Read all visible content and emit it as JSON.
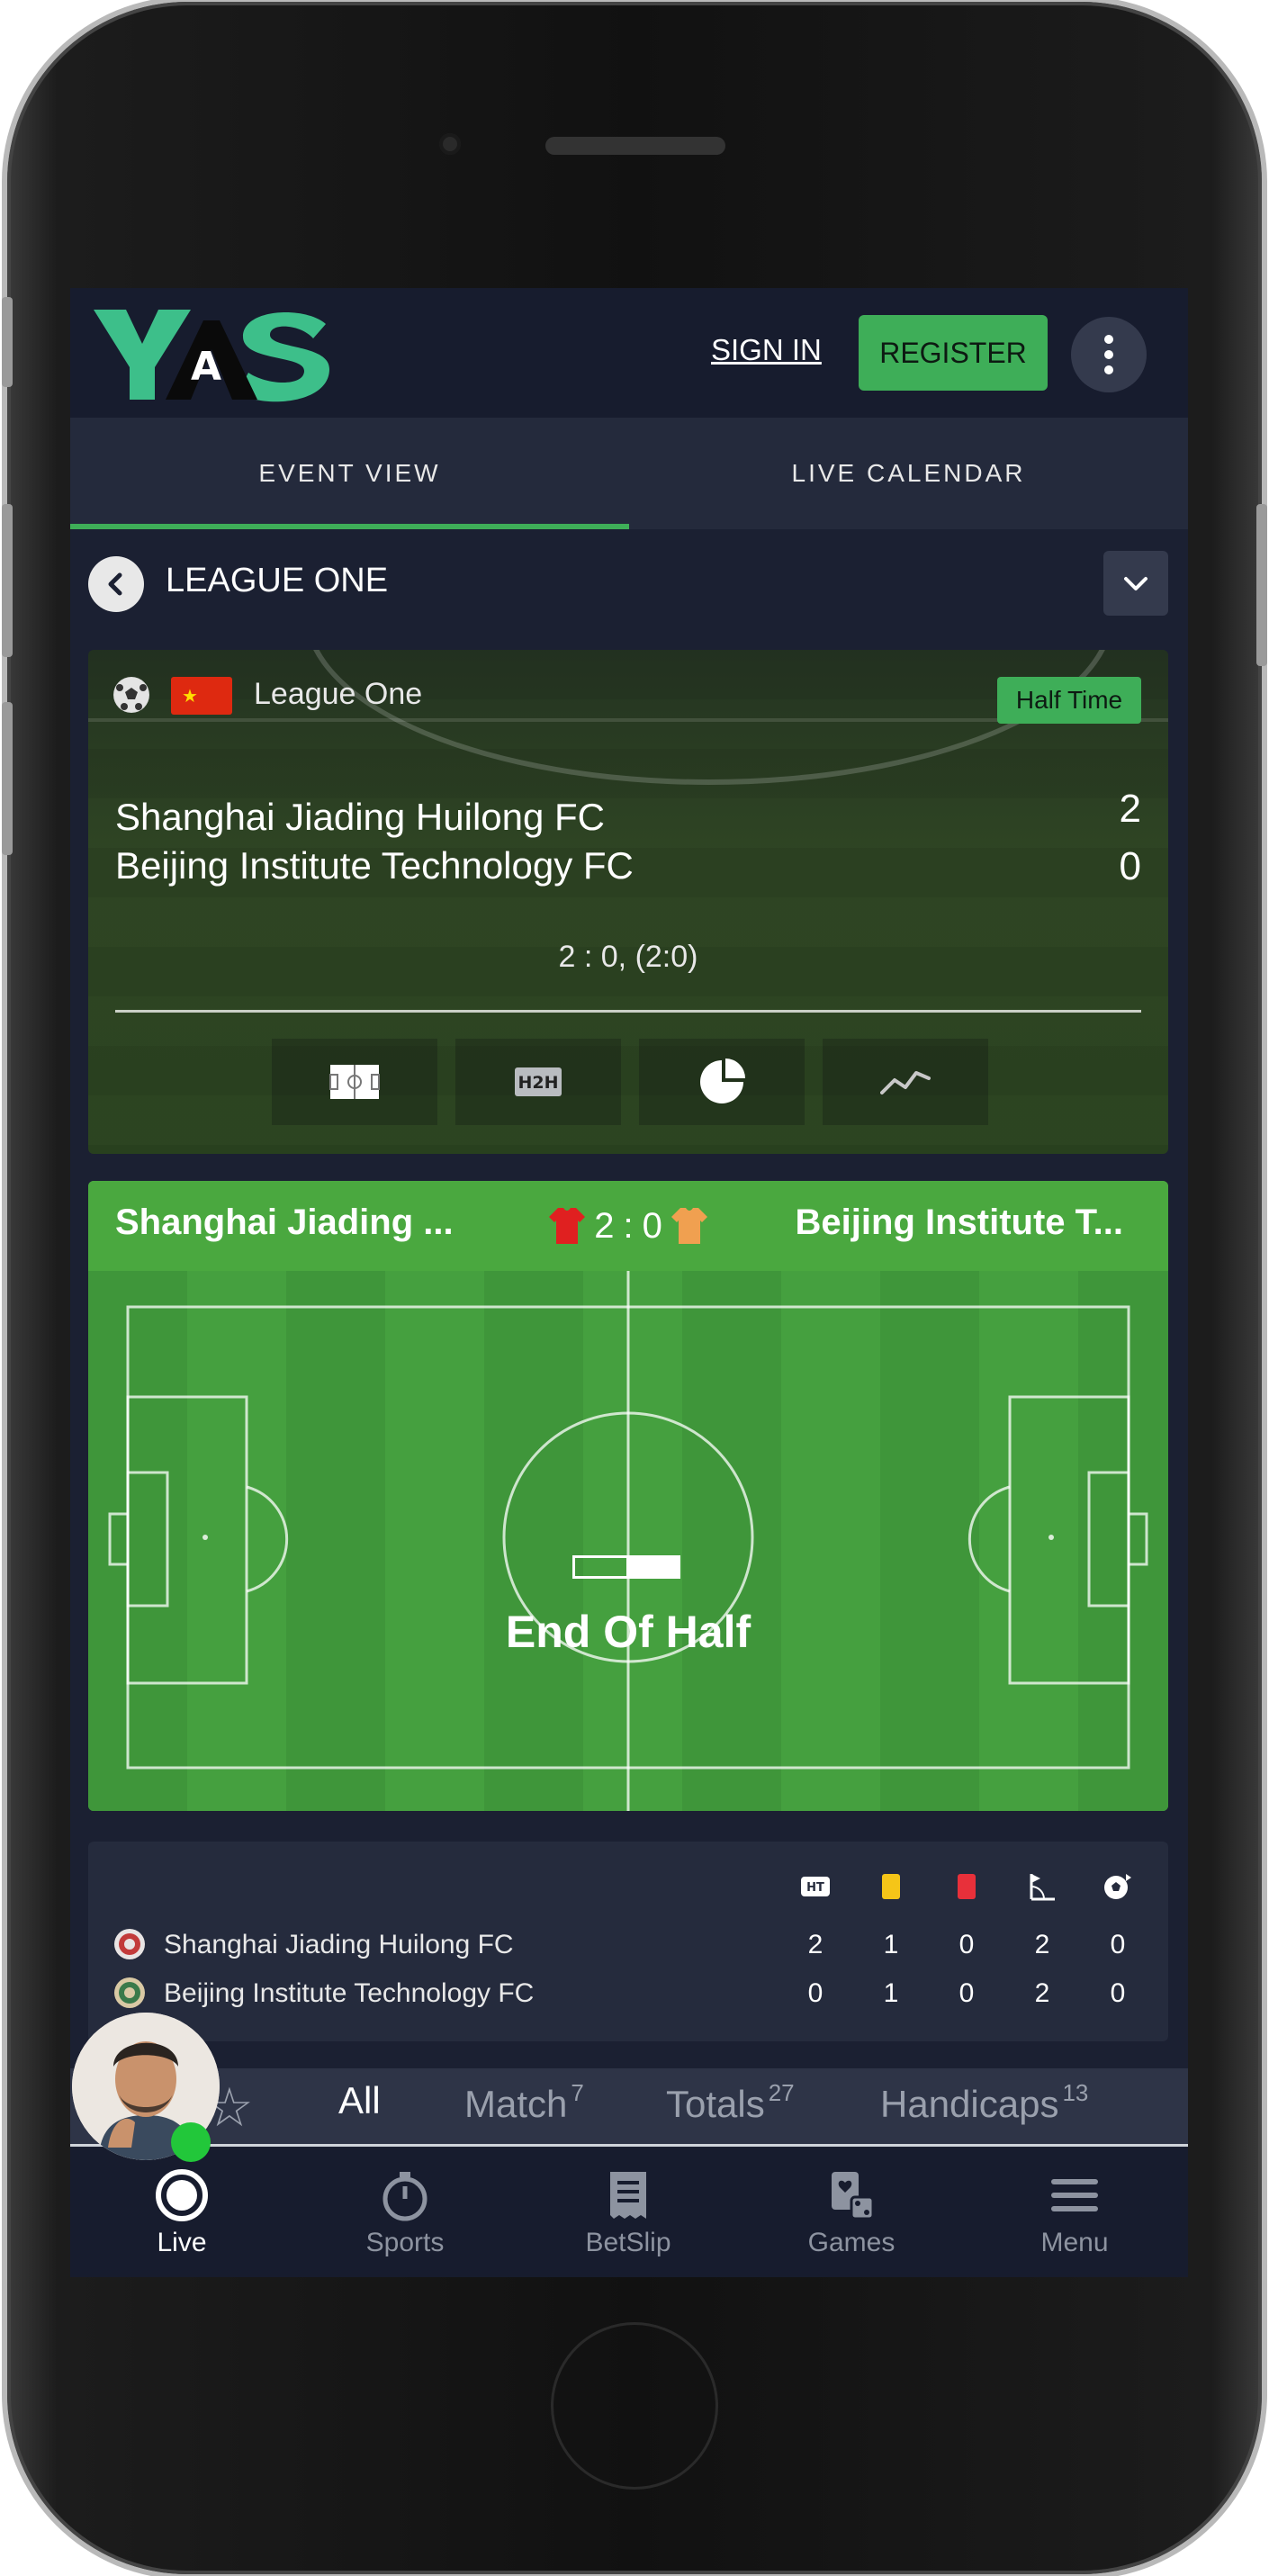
{
  "header": {
    "logo_text": "YAS",
    "signin_label": "SIGN IN",
    "register_label": "REGISTER"
  },
  "tabs": [
    {
      "label": "EVENT VIEW",
      "active": true
    },
    {
      "label": "LIVE CALENDAR",
      "active": false
    }
  ],
  "league_bar": {
    "title": "LEAGUE ONE"
  },
  "match": {
    "competition": "League One",
    "flag": "china-flag",
    "status": "Half Time",
    "home_team": "Shanghai Jiading Huilong FC",
    "away_team": "Beijing Institute Technology FC",
    "home_score": "2",
    "away_score": "0",
    "score_summary": "2 : 0, (2:0)",
    "stat_buttons": [
      "field-icon",
      "h2h-icon",
      "pie-chart-icon",
      "trend-line-icon"
    ],
    "h2h_text": "H2H"
  },
  "live_pitch": {
    "home_team_short": "Shanghai Jiading ...",
    "away_team_short": "Beijing Institute T...",
    "score_home": "2",
    "score_sep": ":",
    "score_away": "0",
    "status_text": "End Of Half",
    "half_progress": 0.5,
    "home_shirt_color": "#e02020",
    "away_shirt_color": "#f0a050"
  },
  "stats_table": {
    "columns": [
      "HT",
      "yellow-card-icon",
      "red-card-icon",
      "corner-flag-icon",
      "goal-ball-icon"
    ],
    "ht_text": "HT",
    "rows": [
      {
        "team": "Shanghai Jiading Huilong FC",
        "values": [
          "2",
          "1",
          "0",
          "2",
          "0"
        ]
      },
      {
        "team": "Beijing Institute Technology FC",
        "values": [
          "0",
          "1",
          "0",
          "2",
          "0"
        ]
      }
    ]
  },
  "market_tabs": [
    {
      "label": "All",
      "count": "",
      "active": true
    },
    {
      "label": "Match",
      "count": "7",
      "active": false
    },
    {
      "label": "Totals",
      "count": "27",
      "active": false
    },
    {
      "label": "Handicaps",
      "count": "13",
      "active": false
    }
  ],
  "bottom_nav": [
    {
      "label": "Live",
      "icon": "live-icon",
      "active": true
    },
    {
      "label": "Sports",
      "icon": "stopwatch-icon",
      "active": false
    },
    {
      "label": "BetSlip",
      "icon": "betslip-icon",
      "active": false
    },
    {
      "label": "Games",
      "icon": "games-icon",
      "active": false
    },
    {
      "label": "Menu",
      "icon": "hamburger-icon",
      "active": false
    }
  ],
  "colors": {
    "accent": "#3eae58",
    "background": "#1b2032",
    "header": "#171c2e",
    "online": "#22c73a"
  }
}
